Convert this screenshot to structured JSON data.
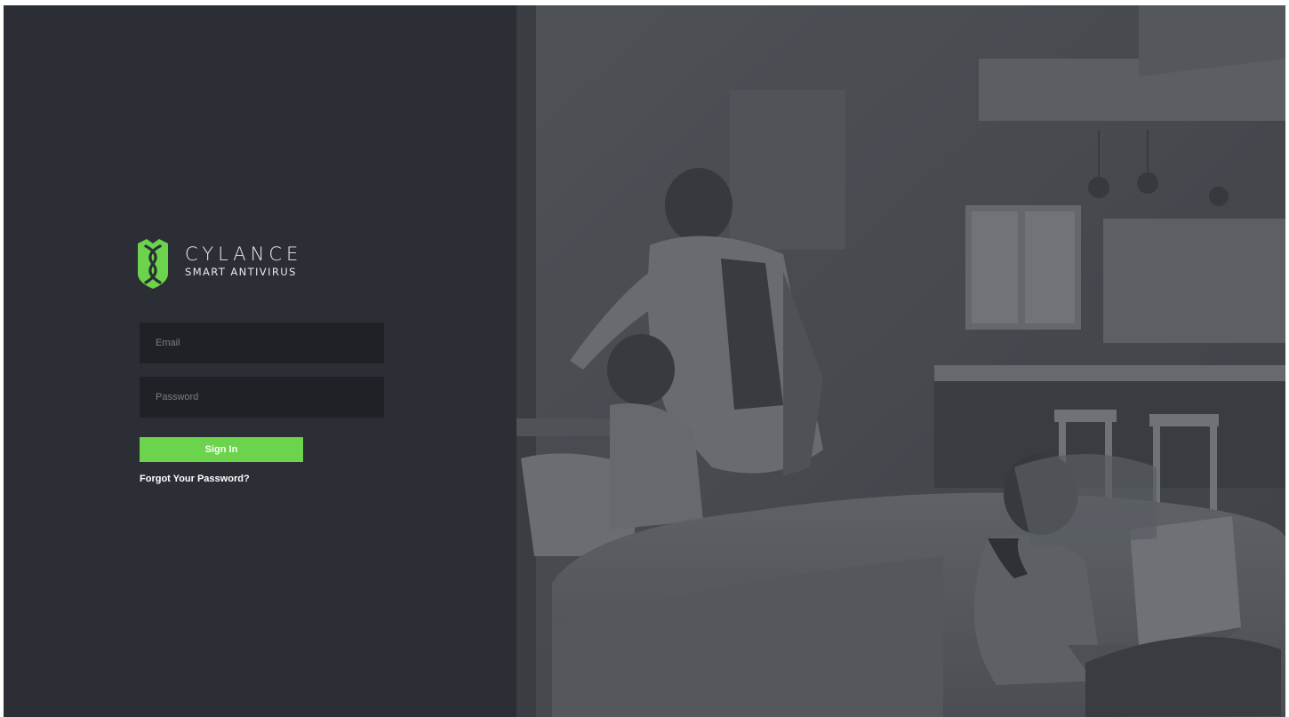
{
  "brand": {
    "name": "CYLANCE",
    "product": "SMART ANTIVIRUS",
    "accent_color": "#6bd34c"
  },
  "login": {
    "email_placeholder": "Email",
    "email_value": "",
    "password_placeholder": "Password",
    "password_value": "",
    "sign_in_label": "Sign In",
    "forgot_password_label": "Forgot Your Password?"
  },
  "hero": {
    "icon": "family-living-room-photo"
  }
}
